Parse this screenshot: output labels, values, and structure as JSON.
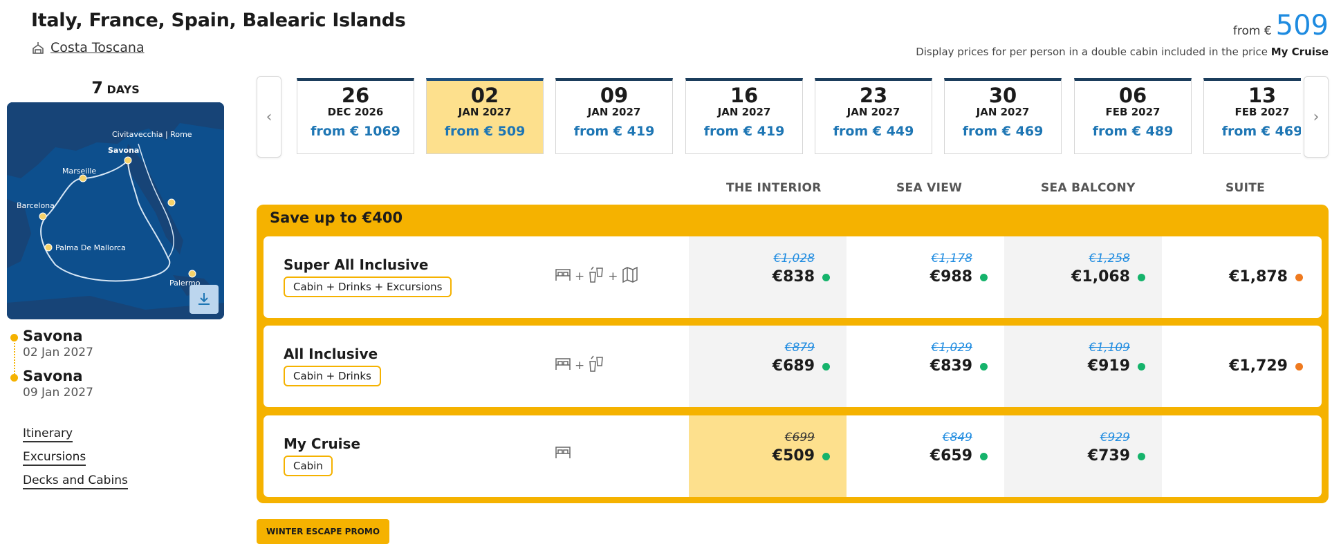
{
  "header": {
    "title": "Italy, France, Spain, Balearic Islands",
    "ship": "Costa Toscana",
    "from_prefix": "from €",
    "from_value": "509",
    "price_note": "Display prices for per person in a double cabin included in the price",
    "price_note_bold": "My Cruise"
  },
  "duration": {
    "number": "7",
    "unit": "DAYS"
  },
  "map": {
    "labels": [
      "Civitavecchia | Rome",
      "Savona",
      "Marseille",
      "Barcelona",
      "Palma De Mallorca",
      "Palermo"
    ]
  },
  "ports": [
    {
      "name": "Savona",
      "date": "02 Jan 2027"
    },
    {
      "name": "Savona",
      "date": "09 Jan 2027"
    }
  ],
  "links": [
    "Itinerary",
    "Excursions",
    "Decks and Cabins"
  ],
  "dates": [
    {
      "day": "26",
      "month": "DEC 2026",
      "price": "from € 1069"
    },
    {
      "day": "02",
      "month": "JAN 2027",
      "price": "from € 509"
    },
    {
      "day": "09",
      "month": "JAN 2027",
      "price": "from € 419"
    },
    {
      "day": "16",
      "month": "JAN 2027",
      "price": "from € 419"
    },
    {
      "day": "23",
      "month": "JAN 2027",
      "price": "from € 449"
    },
    {
      "day": "30",
      "month": "JAN 2027",
      "price": "from € 469"
    },
    {
      "day": "06",
      "month": "FEB 2027",
      "price": "from € 489"
    },
    {
      "day": "13",
      "month": "FEB 2027",
      "price": "from € 469"
    }
  ],
  "selected_date_index": 1,
  "columns": [
    "THE INTERIOR",
    "SEA VIEW",
    "SEA BALCONY",
    "SUITE"
  ],
  "panel_title": "Save up to €400",
  "packages": [
    {
      "name": "Super All Inclusive",
      "tag": "Cabin + Drinks + Excursions",
      "icons": [
        "bed-icon",
        "drinks-icon",
        "map-icon"
      ],
      "prices": [
        {
          "old": "€1,028",
          "new": "€838",
          "status": "green"
        },
        {
          "old": "€1,178",
          "new": "€988",
          "status": "green"
        },
        {
          "old": "€1,258",
          "new": "€1,068",
          "status": "green"
        },
        {
          "old": "",
          "new": "€1,878",
          "status": "orange"
        }
      ]
    },
    {
      "name": "All Inclusive",
      "tag": "Cabin + Drinks",
      "icons": [
        "bed-icon",
        "drinks-icon"
      ],
      "prices": [
        {
          "old": "€879",
          "new": "€689",
          "status": "green"
        },
        {
          "old": "€1,029",
          "new": "€839",
          "status": "green"
        },
        {
          "old": "€1,109",
          "new": "€919",
          "status": "green"
        },
        {
          "old": "",
          "new": "€1,729",
          "status": "orange"
        }
      ]
    },
    {
      "name": "My Cruise",
      "tag": "Cabin",
      "icons": [
        "bed-icon"
      ],
      "prices": [
        {
          "old": "€699",
          "new": "€509",
          "status": "green"
        },
        {
          "old": "€849",
          "new": "€659",
          "status": "green"
        },
        {
          "old": "€929",
          "new": "€739",
          "status": "green"
        }
      ]
    }
  ],
  "promo": "WINTER ESCAPE PROMO",
  "colors": {
    "accent": "#f5b200",
    "selected": "#fde08d",
    "price_blue": "#1e76b4",
    "available": "#15b36b",
    "limited": "#ef7a1f"
  }
}
